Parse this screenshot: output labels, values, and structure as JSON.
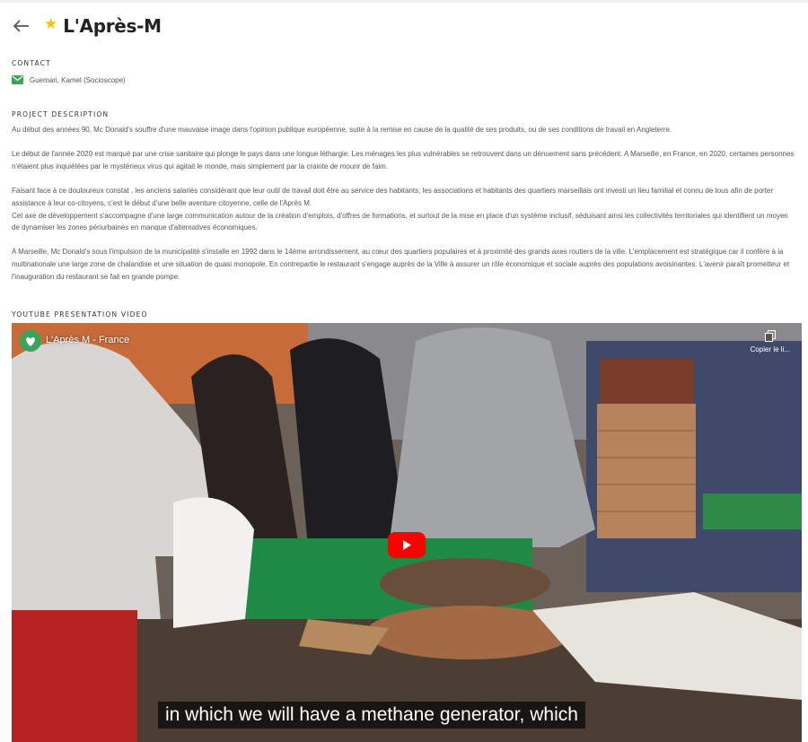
{
  "header": {
    "title": "L'Après-M"
  },
  "contact": {
    "label": "CONTACT",
    "name": "Guemari, Kamel (Socioscope)"
  },
  "description": {
    "label": "PROJECT DESCRIPTION",
    "p1": "Au début des années 90, Mc Donald's souffre d'une mauvaise image dans l'opinion publique européenne, suite à la remise en cause de la qualité de ses produits, ou de ses conditions de travail en Angleterre.",
    "p2": "Le début de l'année 2020 est marqué par une crise sanitaire qui plonge le pays dans une longue léthargie. Les ménages les plus vulnérables se retrouvent dans un dénuement sans précédent. A Marseille, en France, en 2020, certaines personnes n'étaient plus inquiétées par le mystérieux virus qui agitait le monde, mais simplement par la crainte de mourir de faim.",
    "p3a": "Faisant face à ce douloureux constat , les anciens salariés considérant que leur outil de travail doit être au service des habitants, les associations et habitants des quartiers marseillais ont investi un lieu familial et connu de tous afin de porter assistance à leur co-citoyens, c'est le début d'une belle aventure citoyenne, celle de l'Après M.",
    "p3b": "Cet axe de développement s'accompagne d'une large communication autour de la création d'emplois, d'offres de formations, et surtout de la mise en place d'un système inclusif, séduisant ainsi les collectivités territoriales qui identifient un moyen de dynamiser les zones périurbaines en manque d'alternatives économiques.",
    "p4": "A Marseille, Mc Donald's sous l'impulsion de la municipalité s'installe en 1992 dans le 14ème arrondissement, au cœur des quartiers populaires et à proximité des grands axes routiers de la ville. L'emplacement est stratégique car il confère à la multinationale une large zone de chalandise et une situation de quasi monopole. En contrepartie le restaurant s'engage auprès de la Ville à assurer un rôle économique et sociale auprès des populations avoisinantes. L'avenir paraît prometteur et l'inauguration du restaurant se fait en grande pompe."
  },
  "video": {
    "label": "YOUTUBE PRESENTATION VIDEO",
    "title": "L'Après M - France",
    "copy_label": "Copier le li...",
    "caption": "in which we will have a methane generator, which"
  },
  "colors": {
    "star": "#f4c20d",
    "mail_icon": "#3aa55a",
    "youtube_red": "#ff0000"
  }
}
